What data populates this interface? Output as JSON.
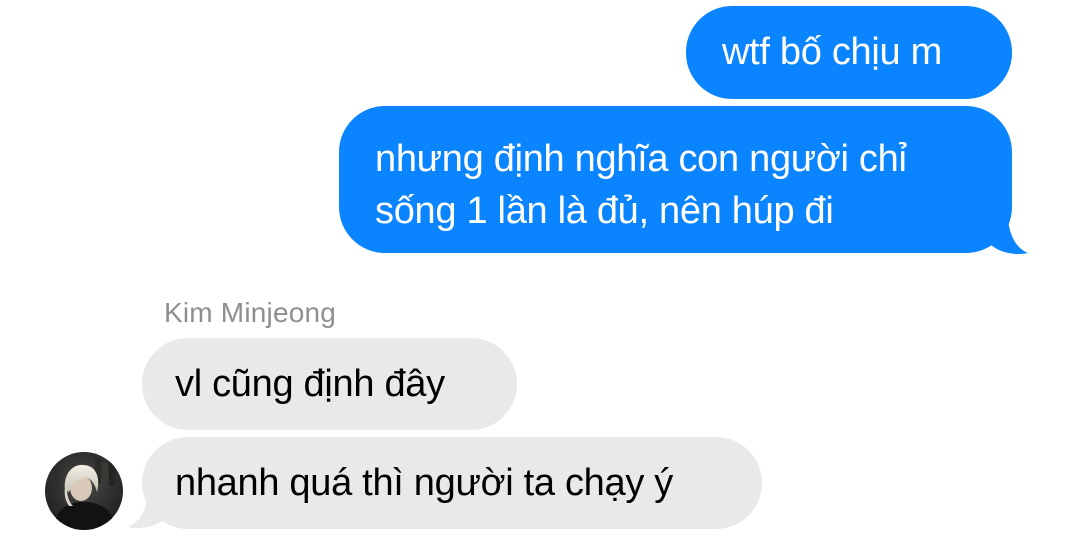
{
  "conversation": {
    "messages": [
      {
        "direction": "sent",
        "text": "wtf bố chịu m"
      },
      {
        "direction": "sent",
        "text": "nhưng định nghĩa con người chỉ sống 1 lần là đủ, nên húp đi"
      },
      {
        "direction": "received",
        "text": "vl cũng định đây"
      },
      {
        "direction": "received",
        "text": "nhanh quá thì người ta chạy ý"
      }
    ],
    "received_group": {
      "sender_name": "Kim Minjeong",
      "avatar_icon": "contact-photo-avatar"
    }
  },
  "colors": {
    "sent_bubble": "#0a84ff",
    "sent_text": "#ffffff",
    "received_bubble": "#e9e9eb",
    "received_text": "#000000",
    "sender_name": "#8e8e93",
    "background": "#ffffff"
  }
}
